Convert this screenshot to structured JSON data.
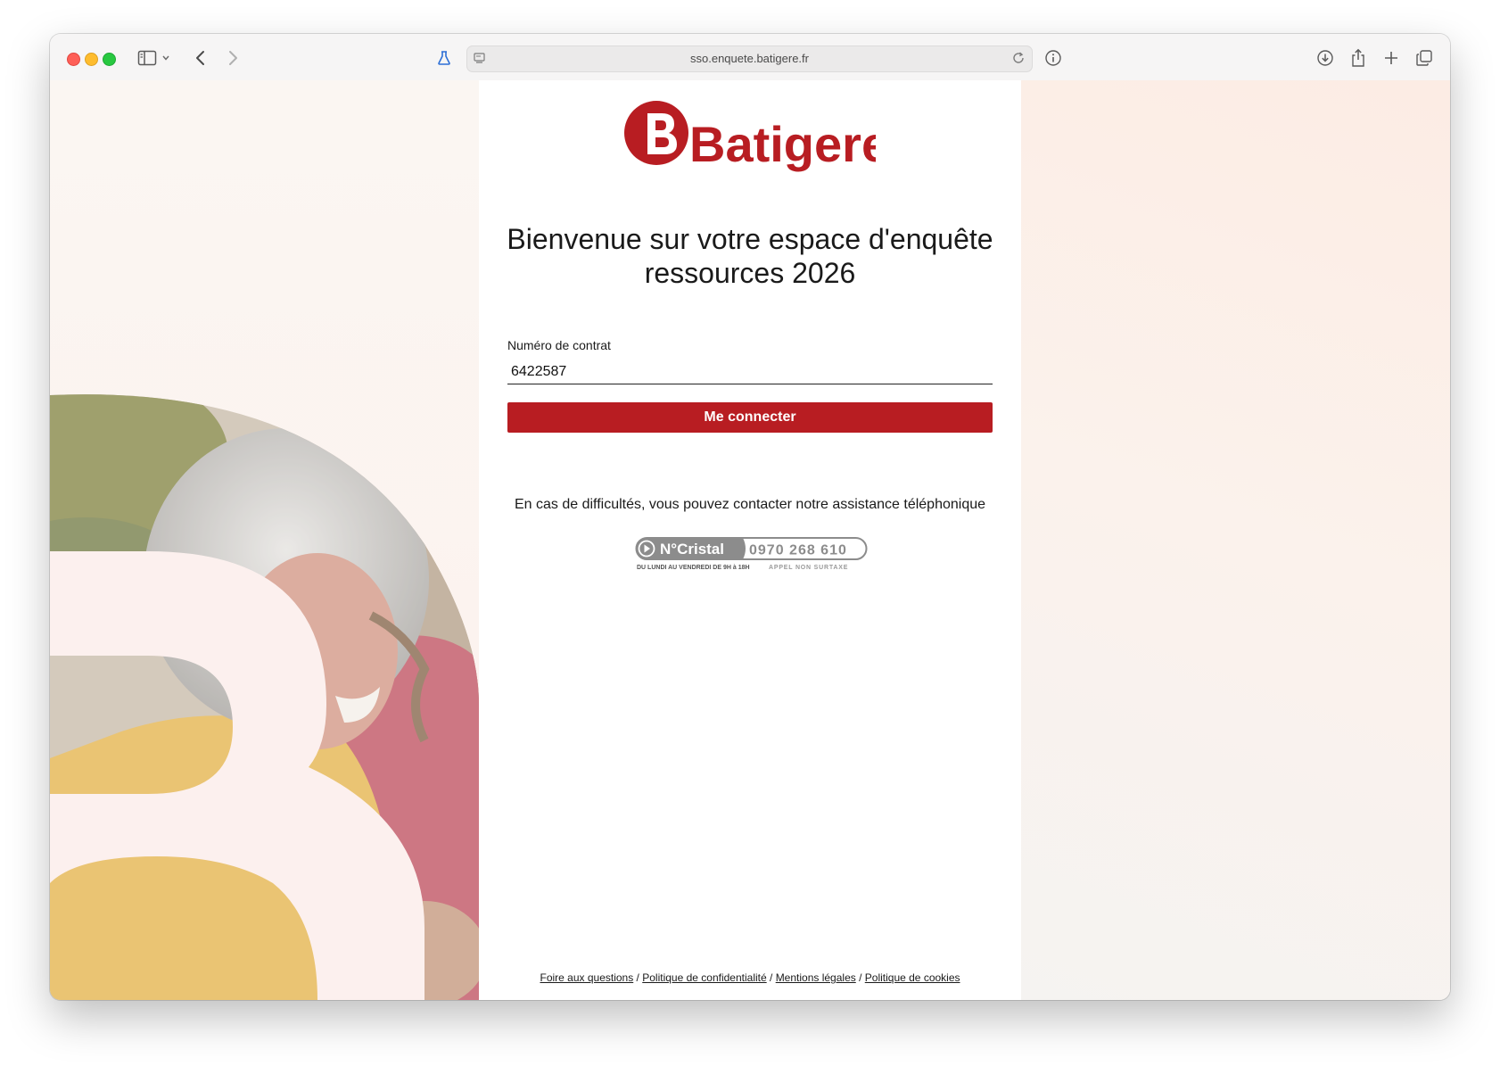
{
  "browser": {
    "url": "sso.enquete.batigere.fr"
  },
  "brand": {
    "logo_text": "Batigere",
    "accent_color": "#b81d22"
  },
  "page": {
    "heading_line1": "Bienvenue sur votre espace d'enquête",
    "heading_line2": "ressources 2026"
  },
  "form": {
    "contract_label": "Numéro de contrat",
    "contract_value": "6422587",
    "submit_label": "Me connecter"
  },
  "help": {
    "text": "En cas de difficultés, vous pouvez contacter notre assistance téléphonique",
    "cristal_label": "N°Cristal",
    "phone": "0970 268 610",
    "hours": "DU LUNDI AU VENDREDI DE 9H à 18H",
    "note": "APPEL NON SURTAXE"
  },
  "footer": {
    "faq": "Foire aux questions",
    "privacy": "Politique de confidentialité",
    "legal": "Mentions légales",
    "cookies": "Politique de cookies",
    "separator": " / "
  },
  "icons": [
    "sidebar-icon",
    "chevron-down-icon",
    "back-icon",
    "forward-icon",
    "flask-icon",
    "page-icon",
    "reload-icon",
    "info-icon",
    "download-icon",
    "share-icon",
    "new-tab-icon",
    "tabs-overview-icon",
    "play-icon"
  ]
}
